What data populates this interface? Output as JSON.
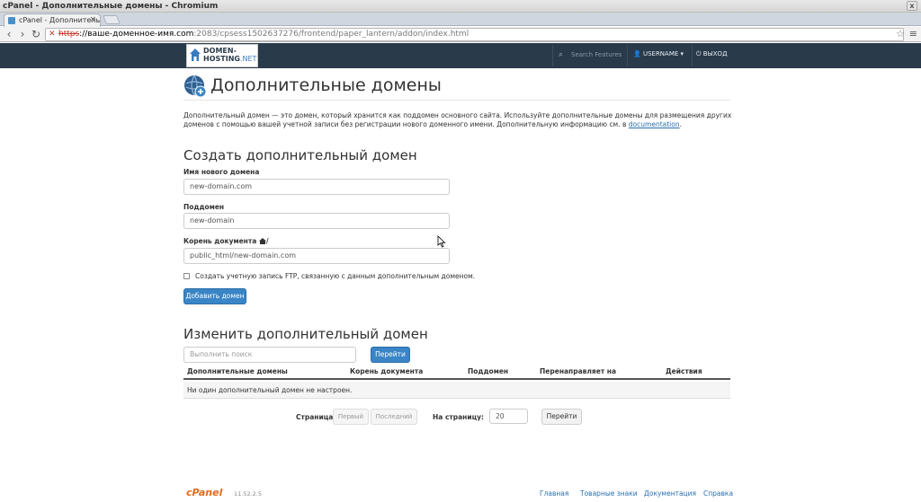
{
  "window": {
    "title": "cPanel - Дополнительные домены - Chromium",
    "close": "x"
  },
  "tab": {
    "label": "cPanel - Дополнительн",
    "close": "×"
  },
  "address": {
    "scheme": "https",
    "host": "://ваше-доменное-имя.com",
    "path": ":2083/cpsess1502637276/frontend/paper_lantern/addon/index.html"
  },
  "brand": {
    "line1": "DOMEN-",
    "line2": "HOSTING",
    "line2_suffix": ".NET"
  },
  "top_nav": {
    "search_placeholder": "Search Features",
    "username": "USERNAME",
    "logout": "ВЫХОД"
  },
  "page": {
    "title": "Дополнительные домены",
    "intro": "Дополнительный домен — это домен, который хранится как поддомен основного сайта. Используйте дополнительные домены для размещения других доменов с помощью вашей учетной записи без регистрации нового доменного имени. Дополнительную информацию см. в ",
    "intro_link": "documentation",
    "intro_end": "."
  },
  "create": {
    "heading": "Создать дополнительный домен",
    "domain_label": "Имя нового домена",
    "domain_value": "new-domain.com",
    "subdomain_label": "Поддомен",
    "subdomain_value": "new-domain",
    "docroot_label": "Корень документа",
    "docroot_suffix": "/",
    "docroot_value": "public_html/new-domain.com",
    "ftp_label": "Создать учетную запись FTP, связанную с данным дополнительным доменом.",
    "submit": "Добавить домен"
  },
  "modify": {
    "heading": "Изменить дополнительный домен",
    "search_placeholder": "Выполнить поиск",
    "search_button": "Перейти",
    "columns": [
      "Дополнительные домены",
      "Корень документа",
      "Поддомен",
      "Перенаправляет на",
      "Действия"
    ],
    "empty": "Ни один дополнительный домен не настроен."
  },
  "pager": {
    "page_label": "Страница:",
    "first": "Первый",
    "last": "Последний",
    "per_page_label": "На страницу:",
    "per_page_value": "20",
    "go": "Перейти"
  },
  "footer": {
    "logo": "cPanel",
    "version": "11.52.2.5",
    "links": [
      "Главная",
      "Товарные знаки",
      "Документация",
      "Справка"
    ]
  },
  "colors": {
    "nav_bg": "#293a4a",
    "primary": "#3a85c6",
    "link": "#2a6fb0",
    "brand_orange": "#e26a1b"
  }
}
